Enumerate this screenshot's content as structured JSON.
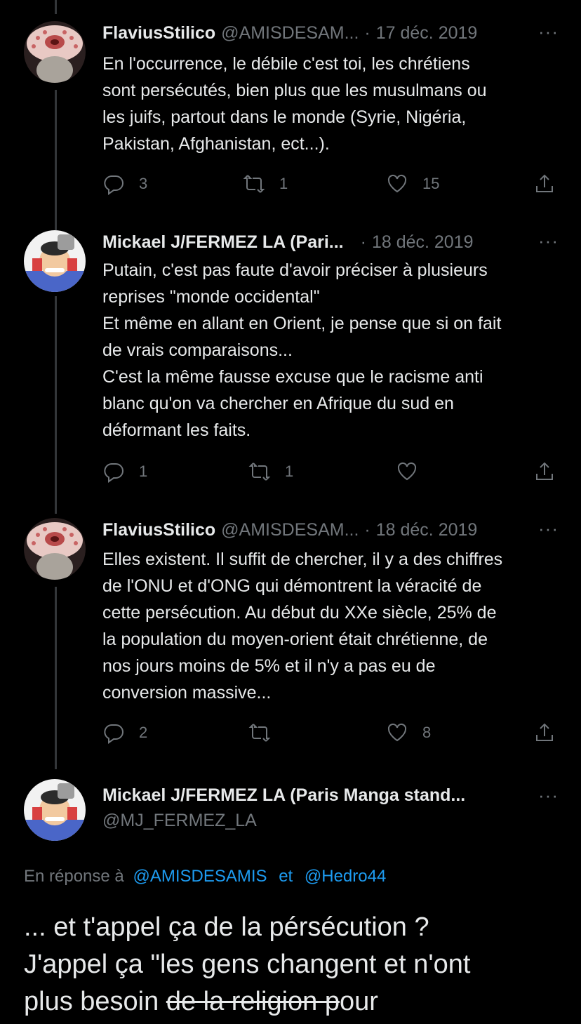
{
  "tweets": [
    {
      "name": "FlaviusStilico",
      "handle": "@AMISDESAM...",
      "dot": "·",
      "date": "17 déc. 2019",
      "more": "···",
      "lines": [
        "En l'occurrence, le débile c'est toi, les chrétiens",
        "sont persécutés, bien plus que les musulmans ou",
        "les juifs, partout dans le monde (Syrie, Nigéria,",
        "Pakistan, Afghanistan, ect...)."
      ],
      "replies": "3",
      "retweets": "1",
      "likes": "15"
    },
    {
      "name": "Mickael J/FERMEZ LA (Pari...",
      "handle": "",
      "dot": "·",
      "date": "18 déc. 2019",
      "more": "···",
      "lines": [
        "Putain, c'est pas faute d'avoir préciser à plusieurs",
        "reprises \"monde occidental\"",
        "Et même en allant en Orient, je pense que si on fait",
        "de vrais comparaisons...",
        "C'est la même fausse excuse que le racisme anti",
        "blanc qu'on va chercher en Afrique du sud en",
        "déformant les faits."
      ],
      "replies": "1",
      "retweets": "1",
      "likes": ""
    },
    {
      "name": "FlaviusStilico",
      "handle": "@AMISDESAM...",
      "dot": "·",
      "date": "18 déc. 2019",
      "more": "···",
      "lines": [
        "Elles existent. Il suffit de chercher, il y a des chiffres",
        "de l'ONU et d'ONG qui démontrent la véracité de",
        "cette persécution.  Au début du XXe siècle, 25% de",
        "la population du moyen-orient était chrétienne, de",
        "nos jours moins de 5% et il n'y a pas eu de",
        "conversion massive..."
      ],
      "replies": "2",
      "retweets": "",
      "likes": "8"
    }
  ],
  "main_tweet": {
    "name": "Mickael J/FERMEZ LA (Paris Manga stand...",
    "handle": "@MJ_FERMEZ_LA",
    "more": "···",
    "reply_prefix": "En réponse à",
    "reply_user1": "@AMISDESAMIS",
    "reply_and": "et",
    "reply_user2": "@Hedro44",
    "line1": "... et t'appel ça de la pérsécution ?",
    "line2": "J'appel ça \"les gens changent et n'ont",
    "line3_a": "plus besoin ",
    "line3_b": "de la religion p",
    "line3_c": "our"
  },
  "icons": {
    "reply": "reply-icon",
    "retweet": "retweet-icon",
    "like": "heart-icon",
    "share": "share-icon"
  },
  "colors": {
    "background": "#000000",
    "text": "#e7e9ea",
    "muted": "#71767b",
    "link": "#1d9bf0"
  }
}
